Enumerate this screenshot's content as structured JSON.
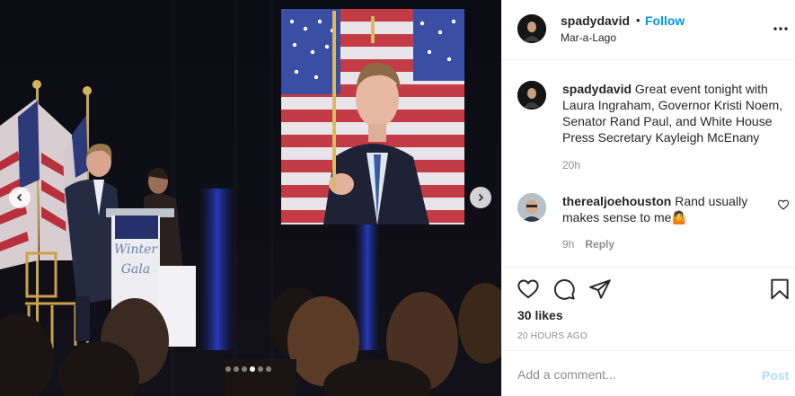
{
  "post": {
    "username": "spadydavid",
    "bullet": "•",
    "follow_label": "Follow",
    "location": "Mar-a-Lago",
    "menu_icon": "more-horizontal-icon"
  },
  "caption": {
    "username": "spadydavid",
    "text": "Great event tonight with Laura Ingraham, Governor Kristi Noem, Senator Rand Paul, and White House Press Secretary Kayleigh McEnany",
    "time": "20h"
  },
  "comments": [
    {
      "username": "therealjoehouston",
      "text": "Rand usually makes sense to me",
      "emoji": "🤷",
      "time": "9h",
      "reply_label": "Reply"
    }
  ],
  "media": {
    "slide_count": 6,
    "active_slide": 4,
    "podium_lines": [
      "Winter",
      "Gala"
    ],
    "icons": [
      "chevron-left-icon",
      "chevron-right-icon"
    ]
  },
  "actions": {
    "icons": [
      "heart-icon",
      "comment-icon",
      "share-icon",
      "bookmark-icon"
    ],
    "likes": "30 likes",
    "timestamp": "20 HOURS AGO"
  },
  "add_comment": {
    "placeholder": "Add a comment...",
    "post_label": "Post"
  },
  "colors": {
    "link": "#0095f6",
    "text": "#262626",
    "muted": "#8e8e8e",
    "post_disabled": "#b2dffc",
    "divider": "#efefef"
  }
}
